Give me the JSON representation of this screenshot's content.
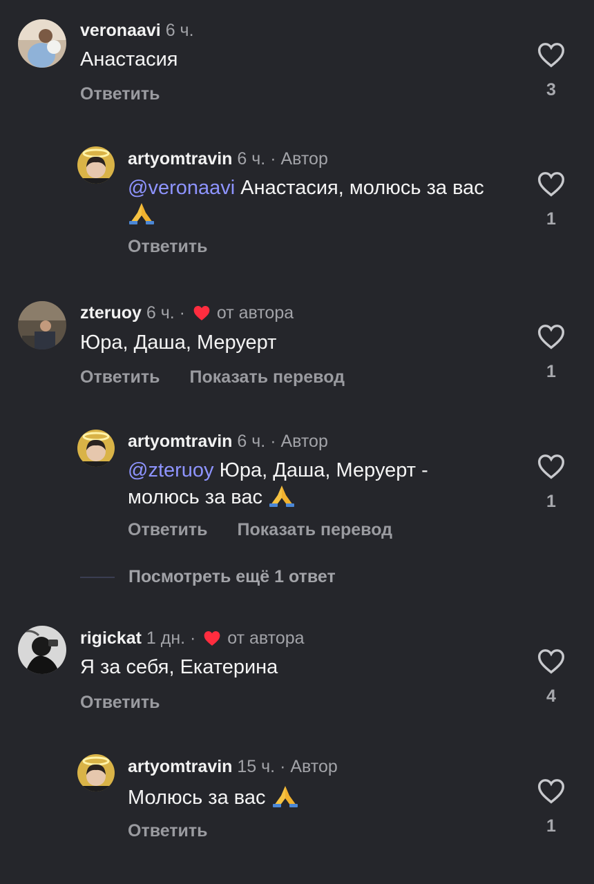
{
  "colors": {
    "background": "#25262b",
    "mention": "#8e94ff",
    "heart_red": "#ff2d3f"
  },
  "comments": [
    {
      "username": "veronaavi",
      "time": "6 ч.",
      "text": "Анастасия",
      "reply_label": "Ответить",
      "likes": "3"
    },
    {
      "username": "artyomtravin",
      "time": "6 ч.",
      "separator": "·",
      "author_label": "Автор",
      "mention": "@veronaavi",
      "text": " Анастасия, молюсь за вас ",
      "reply_label": "Ответить",
      "likes": "1"
    },
    {
      "username": "zteruoy",
      "time": "6 ч.",
      "separator": "·",
      "from_author_label": "от автора",
      "text": "Юра, Даша, Меруерт",
      "reply_label": "Ответить",
      "translate_label": "Показать перевод",
      "likes": "1"
    },
    {
      "username": "artyomtravin",
      "time": "6 ч.",
      "separator": "·",
      "author_label": "Автор",
      "mention": "@zteruoy",
      "text": " Юра, Даша, Меруерт - молюсь за вас ",
      "reply_label": "Ответить",
      "translate_label": "Показать перевод",
      "likes": "1"
    },
    {
      "username": "rigickat",
      "time": "1 дн.",
      "separator": "·",
      "from_author_label": "от автора",
      "text": "Я за себя, Екатерина",
      "reply_label": "Ответить",
      "likes": "4"
    },
    {
      "username": "artyomtravin",
      "time": "15 ч.",
      "separator": "·",
      "author_label": "Автор",
      "text": "Молюсь за вас ",
      "reply_label": "Ответить",
      "likes": "1"
    }
  ],
  "view_more_replies": "Посмотреть ещё 1 ответ",
  "icons": {
    "like": "heart-outline-icon",
    "liked_by_author": "heart-filled-icon",
    "emoji": "folded-hands-emoji"
  }
}
